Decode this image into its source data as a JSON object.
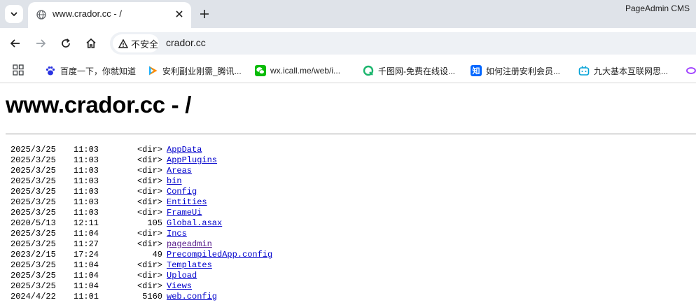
{
  "browser": {
    "tab": {
      "title": "www.crador.cc - /"
    },
    "badge": "PageAdmin CMS",
    "address": {
      "security_label": "不安全",
      "url": "crador.cc"
    },
    "bookmarks": [
      {
        "label": "百度一下，你就知道",
        "icon": "baidu-paw-icon",
        "color": "#2932e1"
      },
      {
        "label": "安利副业刚需_腾讯...",
        "icon": "tencent-video-icon",
        "color": "#ff8c00"
      },
      {
        "label": "wx.icall.me/web/i...",
        "icon": "wechat-icon",
        "color": "#09bb07"
      },
      {
        "label": "千图网-免费在线设...",
        "icon": "qiantu-icon",
        "color": "#1bb56d"
      },
      {
        "label": "如何注册安利会员...",
        "icon": "zhihu-icon",
        "glyph": "知",
        "color": "#0066ff"
      },
      {
        "label": "九大基本互联网思...",
        "icon": "bilibili-tv-icon",
        "color": "#00a1d6"
      }
    ]
  },
  "page": {
    "title": "www.crador.cc - /",
    "entries": [
      {
        "date": "2025/3/25",
        "time": "11:03",
        "size": "<dir>",
        "name": "AppData"
      },
      {
        "date": "2025/3/25",
        "time": "11:03",
        "size": "<dir>",
        "name": "AppPlugins"
      },
      {
        "date": "2025/3/25",
        "time": "11:03",
        "size": "<dir>",
        "name": "Areas"
      },
      {
        "date": "2025/3/25",
        "time": "11:03",
        "size": "<dir>",
        "name": "bin"
      },
      {
        "date": "2025/3/25",
        "time": "11:03",
        "size": "<dir>",
        "name": "Config"
      },
      {
        "date": "2025/3/25",
        "time": "11:03",
        "size": "<dir>",
        "name": "Entities"
      },
      {
        "date": "2025/3/25",
        "time": "11:03",
        "size": "<dir>",
        "name": "FrameUi"
      },
      {
        "date": "2020/5/13",
        "time": "12:11",
        "size": "105",
        "name": "Global.asax"
      },
      {
        "date": "2025/3/25",
        "time": "11:04",
        "size": "<dir>",
        "name": "Incs"
      },
      {
        "date": "2025/3/25",
        "time": "11:27",
        "size": "<dir>",
        "name": "pageadmin",
        "visited": true
      },
      {
        "date": "2023/2/15",
        "time": "17:24",
        "size": "49",
        "name": "PrecompiledApp.config"
      },
      {
        "date": "2025/3/25",
        "time": "11:04",
        "size": "<dir>",
        "name": "Templates"
      },
      {
        "date": "2025/3/25",
        "time": "11:04",
        "size": "<dir>",
        "name": "Upload"
      },
      {
        "date": "2025/3/25",
        "time": "11:04",
        "size": "<dir>",
        "name": "Views"
      },
      {
        "date": "2024/4/22",
        "time": "11:01",
        "size": "5160",
        "name": "web.config"
      }
    ]
  }
}
